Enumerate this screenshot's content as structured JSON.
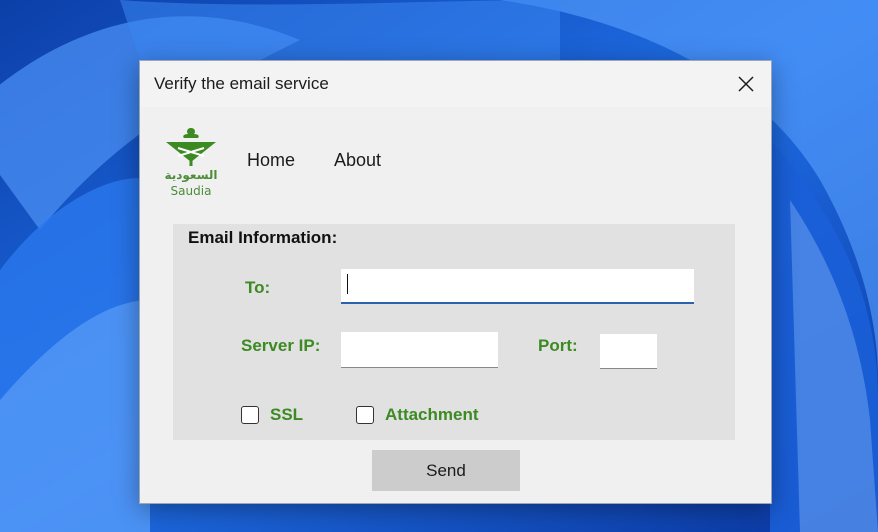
{
  "window": {
    "title": "Verify the email service"
  },
  "logo": {
    "arabic_text": "السعودية",
    "english_text": "Saudia",
    "brand_color": "#3c8a22"
  },
  "menu": {
    "items": [
      {
        "label": "Home"
      },
      {
        "label": "About"
      }
    ]
  },
  "email_info": {
    "title": "Email Information:",
    "to_label": "To:",
    "to_value": "",
    "server_ip_label": "Server IP:",
    "server_ip_value": "",
    "port_label": "Port:",
    "port_value": "",
    "ssl_label": "SSL",
    "ssl_checked": false,
    "attachment_label": "Attachment",
    "attachment_checked": false
  },
  "actions": {
    "send_label": "Send"
  },
  "icons": {
    "close": "close-icon",
    "logo": "saudia-logo-icon"
  },
  "colors": {
    "label_green": "#3c8a22",
    "focus_blue": "#2b61ad",
    "window_bg": "#f0f0f0",
    "group_bg": "#e1e1e1",
    "button_bg": "#cccccc"
  }
}
